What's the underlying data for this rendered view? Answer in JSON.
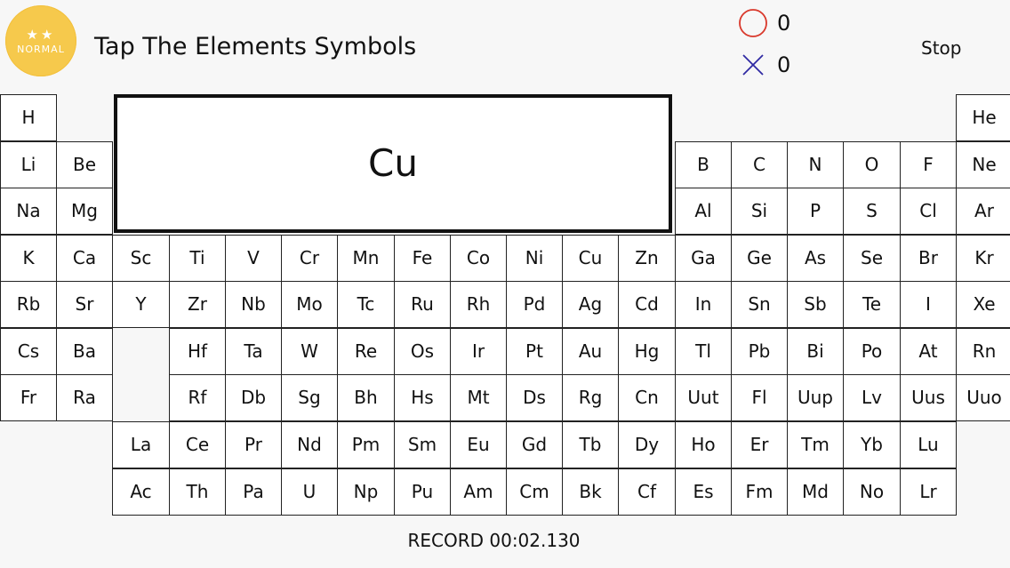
{
  "header": {
    "badge": {
      "stars": "★★",
      "level": "NORMAL"
    },
    "title": "Tap The Elements Symbols",
    "stop_label": "Stop"
  },
  "score": {
    "correct": "0",
    "wrong": "0",
    "correct_color": "#d9382b",
    "wrong_color": "#2f2aa3"
  },
  "prompt_symbol": "Cu",
  "record": "RECORD 00:02.130",
  "table": {
    "rows": [
      [
        "H",
        "",
        "",
        "",
        "",
        "",
        "",
        "",
        "",
        "",
        "",
        "",
        "",
        "",
        "",
        "",
        "",
        "He"
      ],
      [
        "Li",
        "Be",
        "",
        "",
        "",
        "",
        "",
        "",
        "",
        "",
        "",
        "",
        "B",
        "C",
        "N",
        "O",
        "F",
        "Ne"
      ],
      [
        "Na",
        "Mg",
        "",
        "",
        "",
        "",
        "",
        "",
        "",
        "",
        "",
        "",
        "Al",
        "Si",
        "P",
        "S",
        "Cl",
        "Ar"
      ],
      [
        "K",
        "Ca",
        "Sc",
        "Ti",
        "V",
        "Cr",
        "Mn",
        "Fe",
        "Co",
        "Ni",
        "Cu",
        "Zn",
        "Ga",
        "Ge",
        "As",
        "Se",
        "Br",
        "Kr"
      ],
      [
        "Rb",
        "Sr",
        "Y",
        "Zr",
        "Nb",
        "Mo",
        "Tc",
        "Ru",
        "Rh",
        "Pd",
        "Ag",
        "Cd",
        "In",
        "Sn",
        "Sb",
        "Te",
        "I",
        "Xe"
      ],
      [
        "Cs",
        "Ba",
        "",
        "Hf",
        "Ta",
        "W",
        "Re",
        "Os",
        "Ir",
        "Pt",
        "Au",
        "Hg",
        "Tl",
        "Pb",
        "Bi",
        "Po",
        "At",
        "Rn"
      ],
      [
        "Fr",
        "Ra",
        "",
        "Rf",
        "Db",
        "Sg",
        "Bh",
        "Hs",
        "Mt",
        "Ds",
        "Rg",
        "Cn",
        "Uut",
        "Fl",
        "Uup",
        "Lv",
        "Uus",
        "Uuo"
      ]
    ],
    "lanthanides": [
      "La",
      "Ce",
      "Pr",
      "Nd",
      "Pm",
      "Sm",
      "Eu",
      "Gd",
      "Tb",
      "Dy",
      "Ho",
      "Er",
      "Tm",
      "Yb",
      "Lu"
    ],
    "actinides": [
      "Ac",
      "Th",
      "Pa",
      "U",
      "Np",
      "Pu",
      "Am",
      "Cm",
      "Bk",
      "Cf",
      "Es",
      "Fm",
      "Md",
      "No",
      "Lr"
    ]
  }
}
